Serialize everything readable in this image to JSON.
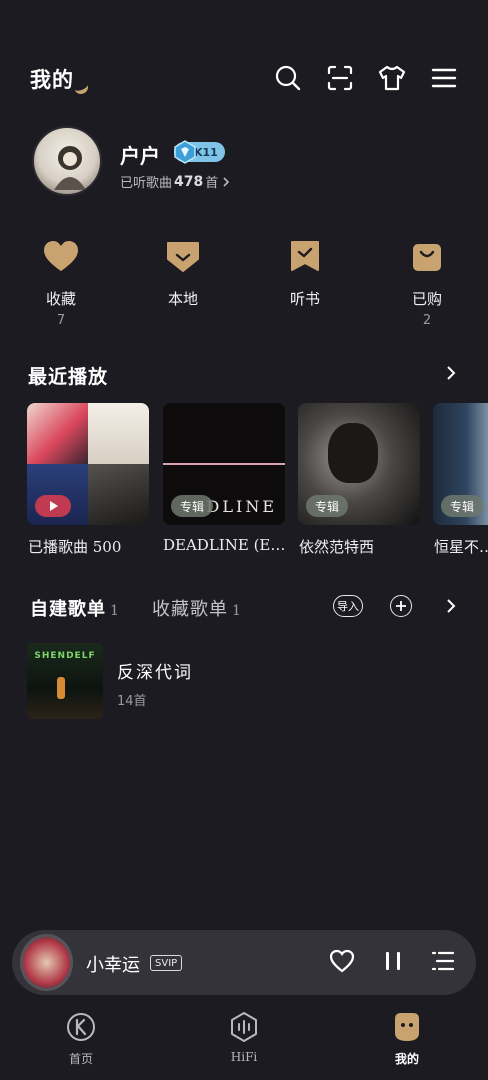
{
  "header": {
    "title": "我的",
    "icons": [
      "search-icon",
      "scan-icon",
      "shirt-icon",
      "menu-icon"
    ]
  },
  "profile": {
    "username": "户户",
    "level": "K11",
    "heard_prefix": "已听歌曲",
    "heard_count": "478",
    "heard_suffix": "首"
  },
  "quick_actions": [
    {
      "label": "收藏",
      "count": "7",
      "icon": "heart-icon"
    },
    {
      "label": "本地",
      "count": "",
      "icon": "download-icon"
    },
    {
      "label": "听书",
      "count": "",
      "icon": "bookmark-icon"
    },
    {
      "label": "已购",
      "count": "2",
      "icon": "bag-icon"
    }
  ],
  "recent": {
    "title": "最近播放",
    "items": [
      {
        "label": "已播歌曲 500",
        "tag": ""
      },
      {
        "label": "DEADLINE (E…",
        "tag": "专辑",
        "cover_text": "DLINE"
      },
      {
        "label": "依然范特西",
        "tag": "专辑"
      },
      {
        "label": "恒星不…",
        "tag": "专辑"
      }
    ]
  },
  "playlists": {
    "tab_created": "自建歌单",
    "tab_created_count": "1",
    "tab_collected": "收藏歌单",
    "tab_collected_count": "1",
    "import_label": "导入",
    "items": [
      {
        "name": "反深代词",
        "count": "14首",
        "cover_text": "SHENDELF"
      }
    ]
  },
  "player": {
    "title": "小幸运",
    "badge": "SVIP"
  },
  "nav": [
    {
      "label": "首页",
      "icon": "k-logo-icon"
    },
    {
      "label": "HiFi",
      "icon": "hifi-icon"
    },
    {
      "label": "我的",
      "icon": "profile-face-icon"
    }
  ],
  "colors": {
    "background": "#1c1b21",
    "accent": "#c9a36f",
    "player_bg": "#34333a"
  }
}
